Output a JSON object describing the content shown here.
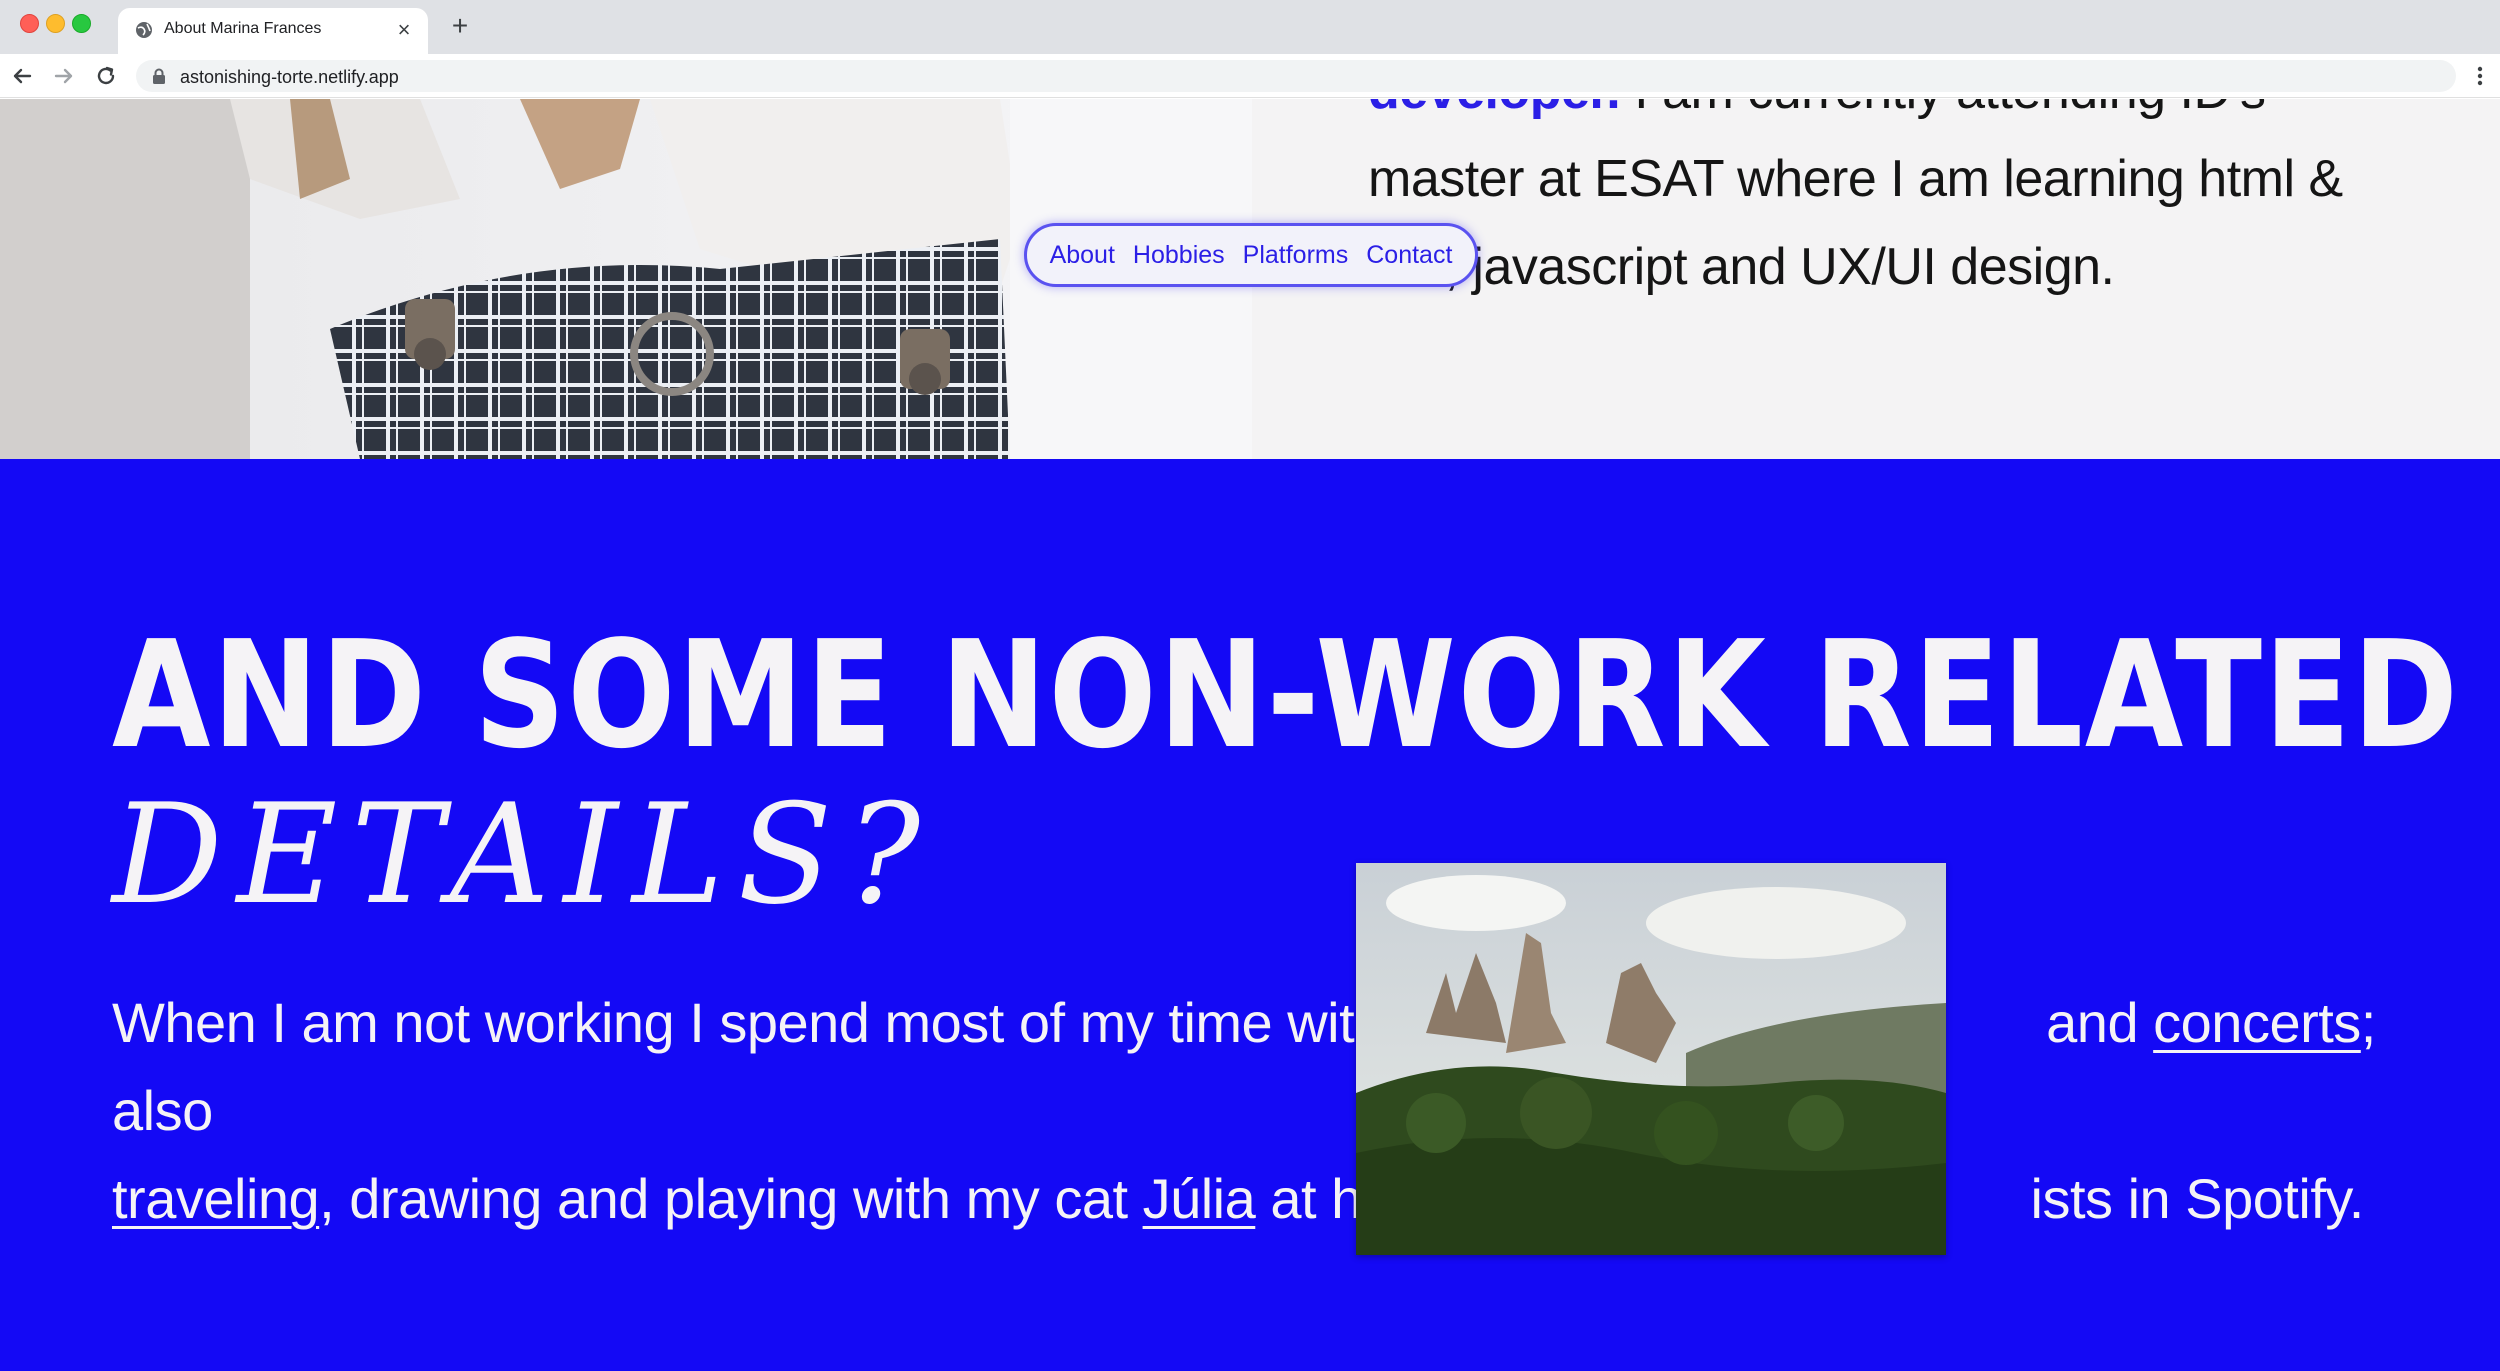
{
  "browser": {
    "tab_title": "About Marina Frances",
    "url": "astonishing-torte.netlify.app"
  },
  "nav": {
    "links": [
      "About",
      "Hobbies",
      "Platforms",
      "Contact"
    ]
  },
  "bio": {
    "line0_highlight": "developer.",
    "line0_rest": " I am currently attending ID's",
    "line1": "master at ESAT where I am learning html &",
    "line2": "css, javascript and UX/UI design."
  },
  "hobbies": {
    "heading_line1": "AND SOME NON-WORK RELATED",
    "heading_line2": "DETAILS?",
    "para_part1": "When I am not working I spend most of my time with fr",
    "para_part2": " and ",
    "link_concerts": "concerts",
    "para_part3": "; also",
    "link_traveling": "traveling",
    "para_part4": ", drawing and playing with my cat ",
    "link_julia": "Júlia",
    "para_part5": " at hom",
    "para_part6": "ists in Spotify."
  },
  "colors": {
    "accent_blue": "#1409f5",
    "nav_text": "#2b1fe6",
    "page_bg": "#f4f3f4"
  }
}
